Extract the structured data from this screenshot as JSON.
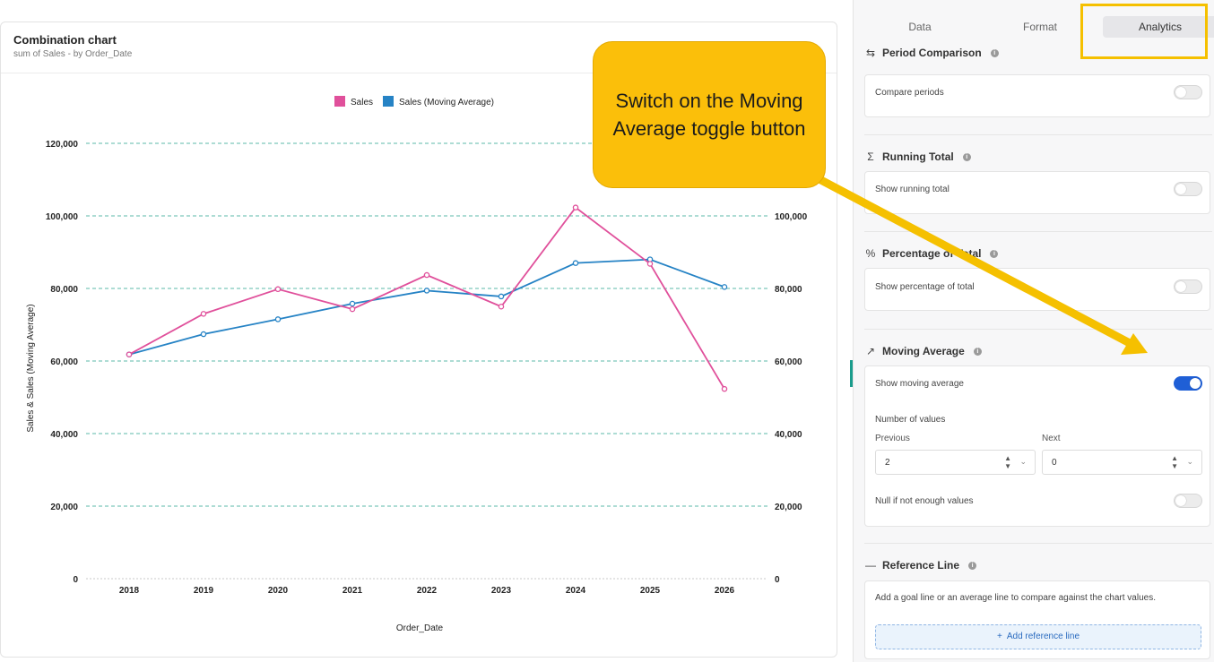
{
  "chart": {
    "title": "Combination chart",
    "subtitle": "sum of Sales - by Order_Date"
  },
  "chart_data": {
    "type": "line",
    "categories": [
      "2018",
      "2019",
      "2020",
      "2021",
      "2022",
      "2023",
      "2024",
      "2025",
      "2026"
    ],
    "series": [
      {
        "name": "Sales",
        "color": "#e0509b",
        "values": [
          61800,
          73000,
          79800,
          74300,
          83700,
          75000,
          102300,
          86800,
          52300
        ]
      },
      {
        "name": "Sales (Moving Average)",
        "color": "#2683c5",
        "values": [
          61800,
          67400,
          71500,
          75800,
          79400,
          77800,
          87000,
          88000,
          80400
        ]
      }
    ],
    "xlabel": "Order_Date",
    "ylabel": "Sales & Sales (Moving Average)",
    "ylim": [
      0,
      120000
    ],
    "left_ticks": [
      "0",
      "20,000",
      "40,000",
      "60,000",
      "80,000",
      "100,000",
      "120,000"
    ],
    "right_ticks": [
      "0",
      "20,000",
      "40,000",
      "60,000",
      "80,000",
      "100,000"
    ],
    "grid": true,
    "grid_color": "#5bb8a8",
    "legend": "top"
  },
  "panel": {
    "tabs": [
      {
        "label": "Data",
        "active": false
      },
      {
        "label": "Format",
        "active": false
      },
      {
        "label": "Analytics",
        "active": true
      }
    ],
    "period_comparison": {
      "title": "Period Comparison",
      "option": "Compare periods",
      "enabled": false
    },
    "running_total": {
      "title": "Running Total",
      "option": "Show running total",
      "enabled": false
    },
    "percentage_of_total": {
      "title": "Percentage of Total",
      "option": "Show percentage of total",
      "enabled": false
    },
    "moving_average": {
      "title": "Moving Average",
      "option": "Show moving average",
      "enabled": true,
      "number_of_values_label": "Number of values",
      "previous_label": "Previous",
      "previous_value": "2",
      "next_label": "Next",
      "next_value": "0",
      "null_label": "Null if not enough values",
      "null_enabled": false
    },
    "reference_line": {
      "title": "Reference Line",
      "description": "Add a goal line or an average line to compare against the chart values.",
      "add_button": "Add reference line"
    }
  },
  "callout": {
    "text": "Switch on the Moving Average toggle button"
  },
  "colors": {
    "accent": "#1f5fd6",
    "highlight": "#f5c000",
    "callout": "#fbbf0a"
  }
}
